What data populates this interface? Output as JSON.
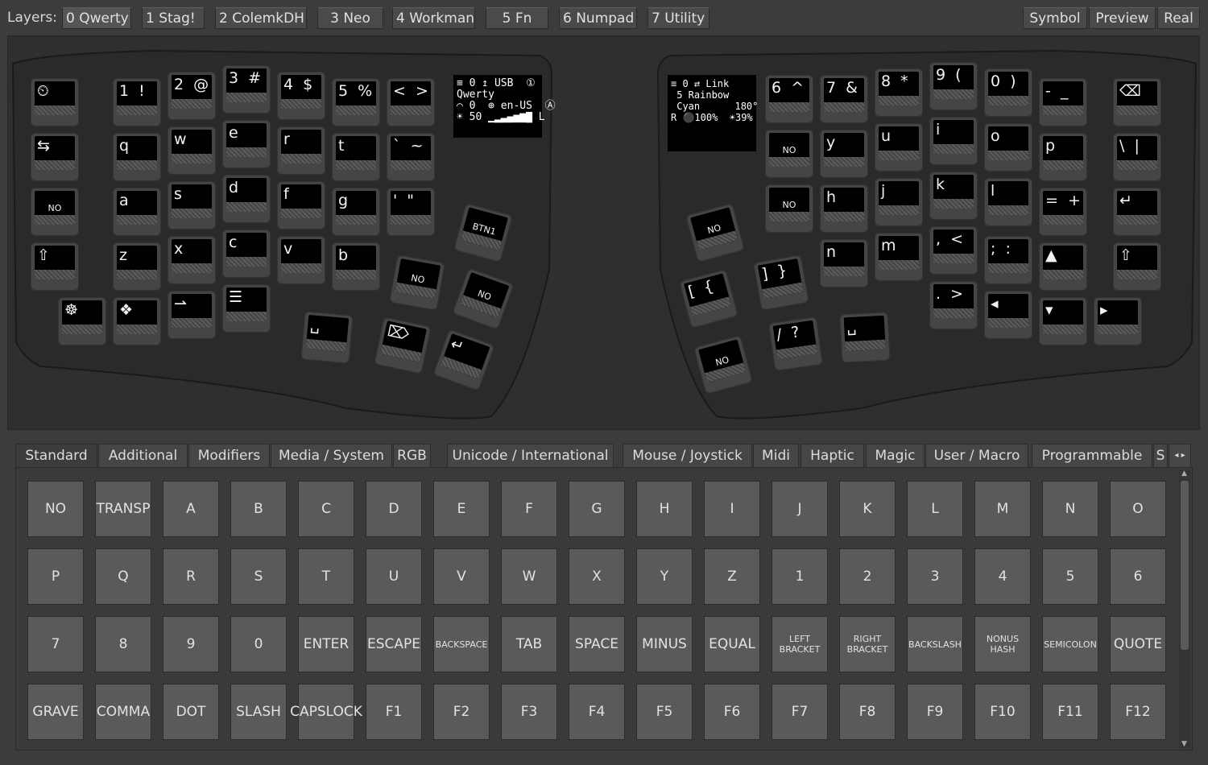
{
  "topbar": {
    "layers_label": "Layers:",
    "layers": [
      "0 Qwerty",
      "1 Stag!",
      "2 ColemkDH",
      "3 Neo",
      "4 Workman",
      "5 Fn",
      "6 Numpad",
      "7 Utility"
    ],
    "right_buttons": [
      "Symbol",
      "Preview",
      "Real"
    ]
  },
  "keyboard": {
    "left_oled": "≡ 0 ↥ USB  ①\nQwerty\n⌒ 0  ⊕ en-US  Ⓐ\n☀ 50 ▁▂▃▄▅▆▇ L",
    "right_oled": "≡ 0 ⇄ Link\n 5 Rainbow\n Cyan      180°\nR ⚫100%  ☀39%",
    "left_keys": [
      {
        "label": "⏲",
        "icon": "clock-reset-icon"
      },
      {
        "label": "1  !"
      },
      {
        "label": "2  @"
      },
      {
        "label": "3  #"
      },
      {
        "label": "4  $"
      },
      {
        "label": "5  %"
      },
      {
        "label": "<  >"
      },
      {
        "label": "⇆",
        "icon": "tab-arrows-icon"
      },
      {
        "label": "q"
      },
      {
        "label": "w"
      },
      {
        "label": "e"
      },
      {
        "label": "r"
      },
      {
        "label": "t"
      },
      {
        "label": "`  ~"
      },
      {
        "label": "NO"
      },
      {
        "label": "a"
      },
      {
        "label": "s"
      },
      {
        "label": "d"
      },
      {
        "label": "f"
      },
      {
        "label": "g"
      },
      {
        "label": "'  \""
      },
      {
        "label": "⇧",
        "icon": "shift-icon"
      },
      {
        "label": "z"
      },
      {
        "label": "x"
      },
      {
        "label": "c"
      },
      {
        "label": "v"
      },
      {
        "label": "b"
      },
      {
        "label": "☸",
        "icon": "wheel-icon"
      },
      {
        "label": "❖",
        "icon": "diamond-icon"
      },
      {
        "label": "⇀",
        "icon": "arrow-icon"
      },
      {
        "label": "☰",
        "icon": "menu-icon"
      },
      {
        "label": "BTN1"
      },
      {
        "label": "NO"
      },
      {
        "label": "NO"
      },
      {
        "label": "␣",
        "icon": "space-icon"
      },
      {
        "label": "⌦",
        "icon": "delete-icon"
      },
      {
        "label": "↵",
        "icon": "enter-icon"
      }
    ],
    "right_keys": [
      {
        "label": "6  ^"
      },
      {
        "label": "7  &"
      },
      {
        "label": "8  *"
      },
      {
        "label": "9  ("
      },
      {
        "label": "0  )"
      },
      {
        "label": "-  _"
      },
      {
        "label": "⌫",
        "icon": "backspace-icon"
      },
      {
        "label": "NO"
      },
      {
        "label": "y"
      },
      {
        "label": "u"
      },
      {
        "label": "i"
      },
      {
        "label": "o"
      },
      {
        "label": "p"
      },
      {
        "label": "\\  |"
      },
      {
        "label": "NO"
      },
      {
        "label": "h"
      },
      {
        "label": "j"
      },
      {
        "label": "k"
      },
      {
        "label": "l"
      },
      {
        "label": "=  +"
      },
      {
        "label": "↵",
        "icon": "enter-icon"
      },
      {
        "label": "NO"
      },
      {
        "label": "n"
      },
      {
        "label": "m"
      },
      {
        "label": ",  <"
      },
      {
        "label": ";  :"
      },
      {
        "label": "▲",
        "icon": "up-icon"
      },
      {
        "label": "⇧",
        "icon": "shift-icon"
      },
      {
        "label": "[  {"
      },
      {
        "label": "]  }"
      },
      {
        "label": ".  >"
      },
      {
        "label": "◂",
        "icon": "left-icon"
      },
      {
        "label": "▾",
        "icon": "down-icon"
      },
      {
        "label": "▸",
        "icon": "right-icon"
      },
      {
        "label": "NO"
      },
      {
        "label": "/  ?"
      },
      {
        "label": "␣",
        "icon": "space-icon"
      }
    ]
  },
  "tabs": [
    "Standard",
    "Additional",
    "Modifiers",
    "Media / System",
    "RGB",
    "Unicode / International",
    "Mouse / Joystick",
    "Midi",
    "Haptic",
    "Magic",
    "User / Macro",
    "Programmable",
    "S"
  ],
  "palette": [
    [
      "NO",
      "TRANSP",
      "A",
      "B",
      "C",
      "D",
      "E",
      "F",
      "G",
      "H",
      "I",
      "J",
      "K",
      "L",
      "M",
      "N",
      "O"
    ],
    [
      "P",
      "Q",
      "R",
      "S",
      "T",
      "U",
      "V",
      "W",
      "X",
      "Y",
      "Z",
      "1",
      "2",
      "3",
      "4",
      "5",
      "6"
    ],
    [
      "7",
      "8",
      "9",
      "0",
      "ENTER",
      "ESCAPE",
      "BACKSPACE",
      "TAB",
      "SPACE",
      "MINUS",
      "EQUAL",
      "LEFT\nBRACKET",
      "RIGHT\nBRACKET",
      "BACKSLASH",
      "NONUS\nHASH",
      "SEMICOLON",
      "QUOTE"
    ],
    [
      "GRAVE",
      "COMMA",
      "DOT",
      "SLASH",
      "CAPSLOCK",
      "F1",
      "F2",
      "F3",
      "F4",
      "F5",
      "F6",
      "F7",
      "F8",
      "F9",
      "F10",
      "F11",
      "F12"
    ]
  ],
  "colors": {
    "background": "#3c3c3c",
    "keycap": "#000000",
    "panel": "#2f2f2f"
  }
}
